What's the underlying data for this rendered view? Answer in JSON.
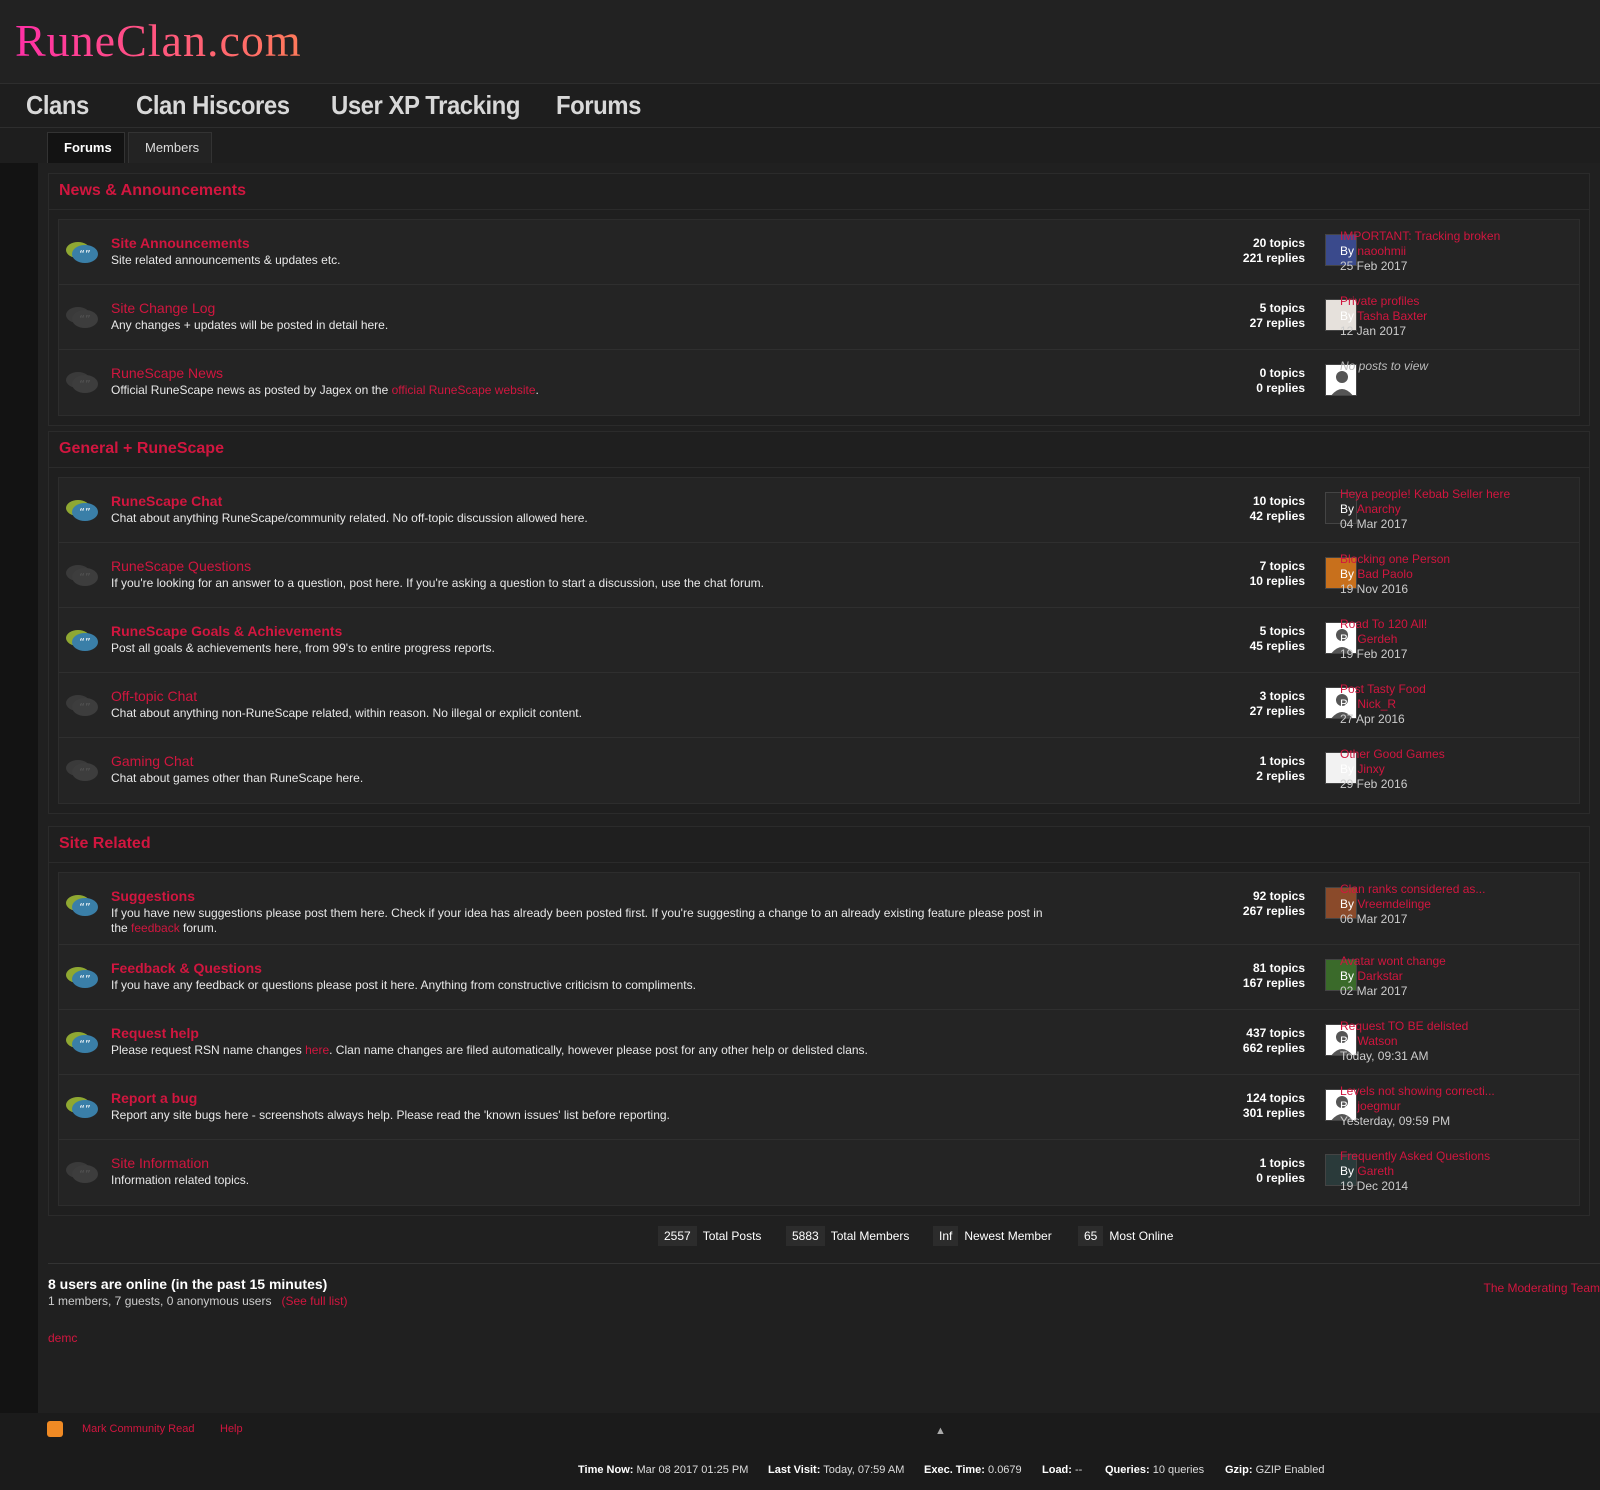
{
  "site": {
    "logo": "RuneClan.com"
  },
  "nav": [
    {
      "label": "Clans"
    },
    {
      "label": "Clan Hiscores"
    },
    {
      "label": "User XP Tracking"
    },
    {
      "label": "Forums"
    }
  ],
  "subtabs": [
    {
      "label": "Forums"
    },
    {
      "label": "Members"
    }
  ],
  "sections": [
    {
      "title": "News & Announcements",
      "forums": [
        {
          "title": "Site Announcements",
          "bold": true,
          "unread": true,
          "desc": "Site related announcements & updates etc.",
          "topics": "20",
          "replies": "221",
          "last_title": "IMPORTANT: Tracking broken",
          "last_by": "naoohmii",
          "last_date": "25 Feb 2017",
          "avatar": "#3a4a8c"
        },
        {
          "title": "Site Change Log",
          "bold": false,
          "unread": false,
          "desc": "Any changes + updates will be posted in detail here.",
          "topics": "5",
          "replies": "27",
          "last_title": "Private profiles",
          "last_by": "Tasha Baxter",
          "last_date": "12 Jan 2017",
          "avatar": "#e6e1dc"
        },
        {
          "title": "RuneScape News",
          "bold": false,
          "unread": false,
          "desc_pre": "Official RuneScape news as posted by Jagex on the ",
          "desc_link": "official RuneScape website",
          "desc_post": ".",
          "topics": "0",
          "replies": "0",
          "no_posts": "No posts to view",
          "avatar": "default"
        }
      ]
    },
    {
      "title": "General + RuneScape",
      "forums": [
        {
          "title": "RuneScape Chat",
          "bold": true,
          "unread": true,
          "desc": "Chat about anything RuneScape/community related. No off-topic discussion allowed here.",
          "topics": "10",
          "replies": "42",
          "last_title": "Heya people! Kebab Seller here",
          "last_by": "Anarchy",
          "last_date": "04 Mar 2017",
          "avatar": "#2a2a2a"
        },
        {
          "title": "RuneScape Questions",
          "bold": false,
          "unread": false,
          "desc": "If you're looking for an answer to a question, post here. If you're asking a question to start a discussion, use the chat forum.",
          "topics": "7",
          "replies": "10",
          "last_title": "Blocking one Person",
          "last_by": "Bad Paolo",
          "last_date": "19 Nov 2016",
          "avatar": "#c8701c"
        },
        {
          "title": "RuneScape Goals & Achievements",
          "bold": true,
          "unread": true,
          "desc": "Post all goals & achievements here, from 99's to entire progress reports.",
          "topics": "5",
          "replies": "45",
          "last_title": "Road To 120 All!",
          "last_by": "Gerdeh",
          "last_date": "19 Feb 2017",
          "avatar": "default"
        },
        {
          "title": "Off-topic Chat",
          "bold": false,
          "unread": false,
          "desc": "Chat about anything non-RuneScape related, within reason. No illegal or explicit content.",
          "topics": "3",
          "replies": "27",
          "last_title": "Post Tasty Food",
          "last_by": "Nick_R",
          "last_date": "27 Apr 2016",
          "avatar": "default"
        },
        {
          "title": "Gaming Chat",
          "bold": false,
          "unread": false,
          "desc": "Chat about games other than RuneScape here.",
          "topics": "1",
          "replies": "2",
          "last_title": "Other Good Games",
          "last_by": "Jinxy",
          "last_date": "29 Feb 2016",
          "avatar": "#f2f2f2"
        }
      ]
    },
    {
      "title": "Site Related",
      "forums": [
        {
          "title": "Suggestions",
          "bold": true,
          "unread": true,
          "desc_pre": "If you have new suggestions please post them here. Check if your idea has already been posted first. If you're suggesting a change to an already existing feature please post in the ",
          "desc_link": "feedback",
          "desc_post": " forum.",
          "topics": "92",
          "replies": "267",
          "last_title": "Clan ranks considered as...",
          "last_by": "Vreemdelinge",
          "last_date": "06 Mar 2017",
          "avatar": "#8a4a2a",
          "tall": true
        },
        {
          "title": "Feedback & Questions",
          "bold": true,
          "unread": true,
          "desc": "If you have any feedback or questions please post it here. Anything from constructive criticism to compliments.",
          "topics": "81",
          "replies": "167",
          "last_title": "Avatar wont change",
          "last_by": "Darkstar",
          "last_date": "02 Mar 2017",
          "avatar": "#3a6a2a"
        },
        {
          "title": "Request help",
          "bold": true,
          "unread": true,
          "desc_pre": "Please request RSN name changes ",
          "desc_link": "here",
          "desc_post": ". Clan name changes are filed automatically, however please post for any other help or delisted clans.",
          "topics": "437",
          "replies": "662",
          "last_title": "Request TO BE delisted",
          "last_by": "Watson",
          "last_date": "Today, 09:31 AM",
          "avatar": "default"
        },
        {
          "title": "Report a bug",
          "bold": true,
          "unread": true,
          "desc": "Report any site bugs here - screenshots always help. Please read the 'known issues' list before reporting.",
          "topics": "124",
          "replies": "301",
          "last_title": "Levels not showing correcti...",
          "last_by": "joegmur",
          "last_date": "Yesterday, 09:59 PM",
          "avatar": "default"
        },
        {
          "title": "Site Information",
          "bold": false,
          "unread": false,
          "desc": "Information related topics.",
          "topics": "1",
          "replies": "0",
          "last_title": "Frequently Asked Questions",
          "last_by": "Gareth",
          "last_date": "19 Dec 2014",
          "avatar": "#2a3a3a"
        }
      ]
    }
  ],
  "labels": {
    "topics": "topics",
    "replies": "replies",
    "by": "By"
  },
  "board_stats": [
    {
      "value": "2557",
      "label": "Total Posts"
    },
    {
      "value": "5883",
      "label": "Total Members"
    },
    {
      "value": "Inf",
      "label": "Newest Member"
    },
    {
      "value": "65",
      "label": "Most Online"
    }
  ],
  "online": {
    "heading": "8 users are online (in the past 15 minutes)",
    "summary": "1 members, 7 guests, 0 anonymous users",
    "full_list": "(See full list)",
    "moderating_team": "The Moderating Team",
    "users": [
      "demc"
    ]
  },
  "footer": {
    "links": [
      "Mark Community Read",
      "Help"
    ],
    "up_arrow": "▲",
    "info": [
      {
        "label": "Time Now:",
        "value": "Mar 08 2017 01:25 PM"
      },
      {
        "label": "Last Visit:",
        "value": "Today, 07:59 AM"
      },
      {
        "label": "Exec. Time:",
        "value": "0.0679"
      },
      {
        "label": "Load:",
        "value": "--"
      },
      {
        "label": "Queries:",
        "value": "10 queries"
      },
      {
        "label": "Gzip:",
        "value": "GZIP Enabled"
      }
    ]
  },
  "colors": {
    "accent": "#d1163f",
    "background": "#1b1b1b"
  }
}
